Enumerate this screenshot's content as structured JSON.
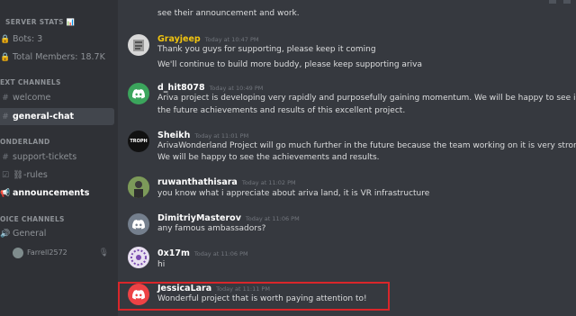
{
  "sidebar": {
    "server_stats": "SERVER STATS 📊",
    "bots": "Bots: 3",
    "members": "Total Members: 18.7K",
    "text_channels_cat": "EXT CHANNELS",
    "channels": [
      {
        "name": "welcome",
        "icon": "#"
      },
      {
        "name": "general-chat",
        "icon": "#"
      }
    ],
    "wonderland_cat": "ONDERLAND",
    "wonderland_channels": [
      {
        "name": "support-tickets",
        "icon": "#"
      },
      {
        "name": "⛓-rules",
        "icon": "☑"
      },
      {
        "name": "announcements",
        "icon": "📢"
      }
    ],
    "voice_cat": "OICE CHANNELS",
    "voice_channel": "General",
    "voice_user": "Farrell2572"
  },
  "messages": [
    {
      "user": "",
      "time": "",
      "lines": [
        "see their announcement and work."
      ]
    },
    {
      "user": "Grayjeep",
      "time": "Today at 10:47 PM",
      "lines": [
        "Thank you guys for supporting, please keep it coming",
        "We'll continue to build more buddy, please keep supporting ariva"
      ],
      "name_color": "#f1c40f"
    },
    {
      "user": "d_hit8078",
      "time": "Today at 10:49 PM",
      "lines": [
        "Ariva project is developing very rapidly and purposefully   gaining momentum. We will be happy to see in",
        "the future achievements and results of this excellent project."
      ],
      "name_color": "#ffffff"
    },
    {
      "user": "Sheikh",
      "time": "Today at 11:01 PM",
      "lines": [
        "ArivaWonderland Project will go much further in the future because the team working on it is very strong.",
        "We will be happy to see the achievements and results."
      ],
      "name_color": "#ffffff",
      "avatar_text": "TROPH"
    },
    {
      "user": "ruwanthathisara",
      "time": "Today at 11:02 PM",
      "lines": [
        "you know what i appreciate about ariva land, it is VR infrastructure"
      ],
      "name_color": "#ffffff"
    },
    {
      "user": "DimitriyMasterov",
      "time": "Today at 11:06 PM",
      "lines": [
        "any famous ambassadors?"
      ],
      "name_color": "#ffffff"
    },
    {
      "user": "0x17m",
      "time": "Today at 11:06 PM",
      "lines": [
        "hi"
      ],
      "name_color": "#ffffff"
    },
    {
      "user": "JessicaLara",
      "time": "Today at 11:11 PM",
      "lines": [
        "Wonderful project that is worth paying attention to!"
      ],
      "name_color": "#ffffff"
    }
  ],
  "colors": {
    "accent": "#d9262a",
    "discord_blurple": "#5865f2",
    "discord_red": "#ed4245"
  }
}
